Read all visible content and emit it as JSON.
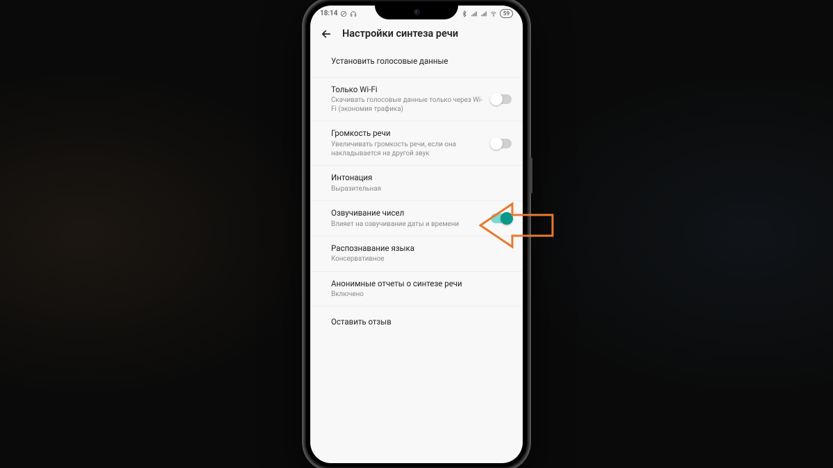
{
  "statusbar": {
    "time": "18:14",
    "battery": "59"
  },
  "header": {
    "title": "Настройки синтеза речи"
  },
  "settings": [
    {
      "title": "Установить голосовые данные",
      "sub": "",
      "toggle": null
    },
    {
      "title": "Только Wi-Fi",
      "sub": "Скачивать голосовые данные только через Wi-Fi (экономия трафика)",
      "toggle": false
    },
    {
      "title": "Громкость речи",
      "sub": "Увеличивать громкость речи, если она накладывается на другой звук",
      "toggle": false
    },
    {
      "title": "Интонация",
      "sub": "Выразительная",
      "toggle": null
    },
    {
      "title": "Озвучивание чисел",
      "sub": "Влияет на озвучивание даты и времени",
      "toggle": true
    },
    {
      "title": "Распознавание языка",
      "sub": "Консервативное",
      "toggle": null
    },
    {
      "title": "Анонимные отчеты о синтезе речи",
      "sub": "Включено",
      "toggle": null
    },
    {
      "title": "Оставить отзыв",
      "sub": "",
      "toggle": null
    }
  ],
  "pointer": {
    "color": "#e77a2f"
  }
}
